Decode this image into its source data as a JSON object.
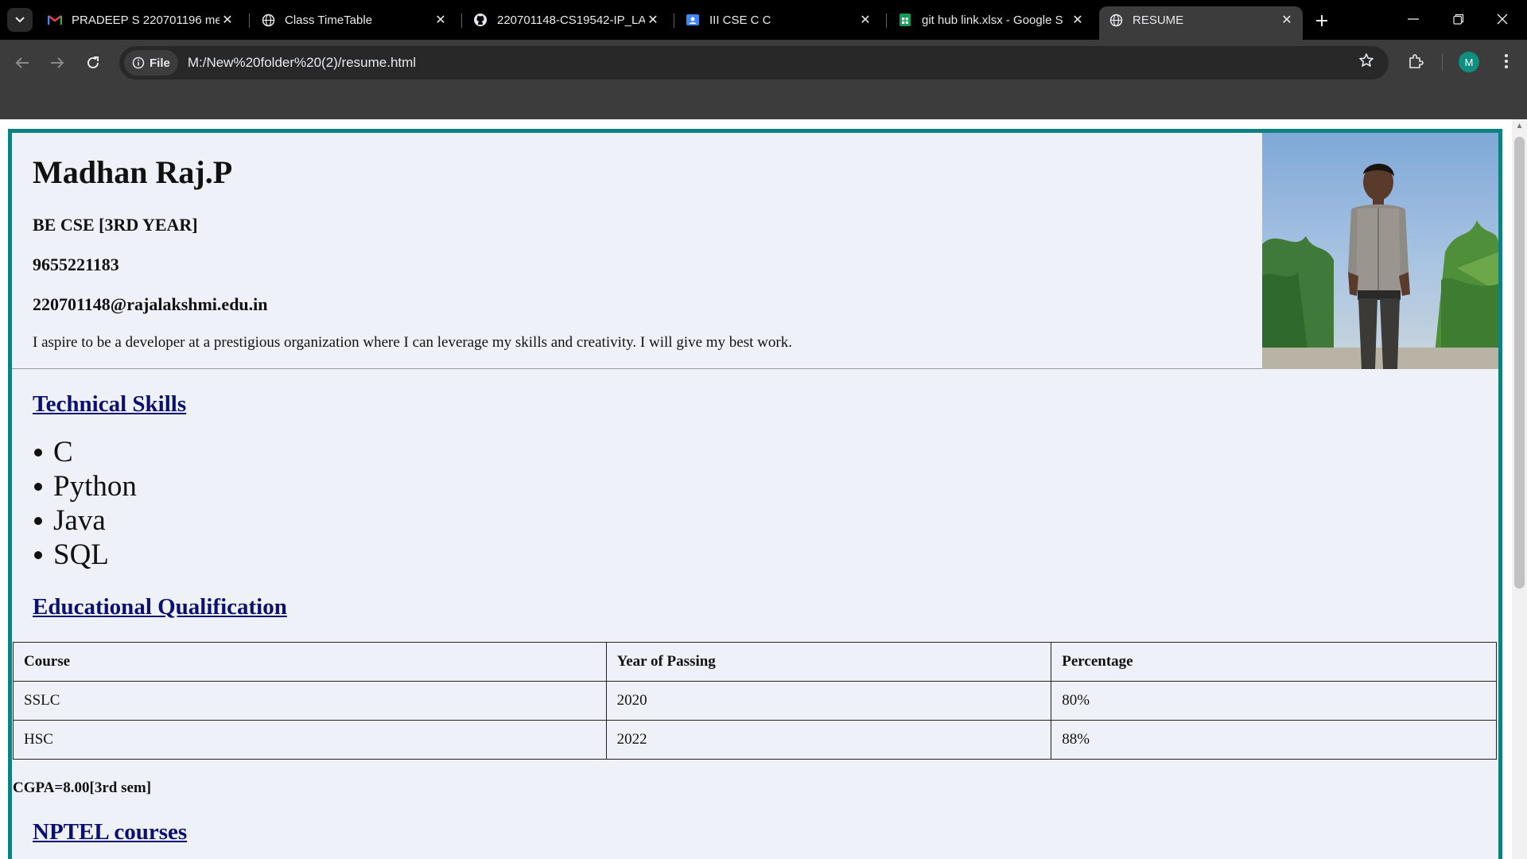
{
  "browser": {
    "tabs": [
      {
        "title": "PRADEEP S 220701196 me",
        "favicon": "gmail-icon",
        "active": false
      },
      {
        "title": "Class TimeTable",
        "favicon": "globe-icon",
        "active": false
      },
      {
        "title": "220701148-CS19542-IP_LA",
        "favicon": "github-icon",
        "active": false
      },
      {
        "title": "III CSE C C",
        "favicon": "classroom-icon",
        "active": false
      },
      {
        "title": "git hub link.xlsx - Google S",
        "favicon": "sheets-icon",
        "active": false
      },
      {
        "title": "RESUME",
        "favicon": "globe-icon",
        "active": true
      }
    ],
    "address": {
      "chip_label": "File",
      "url": "M:/New%20folder%20(2)/resume.html"
    },
    "profile_initial": "M",
    "accent_colors": {
      "profile": "#0f8f7f",
      "gmail": "#ea4335",
      "sheets": "#0f9d58",
      "classroom": "#4285f4"
    }
  },
  "resume": {
    "name": "Madhan Raj.P",
    "degree": "BE CSE [3RD YEAR]",
    "phone": "9655221183",
    "email": "220701148@rajalakshmi.edu.in",
    "objective": "I aspire to be a developer at a prestigious organization where I can leverage my skills and creativity. I will give my best work.",
    "border_color": "#0f8080",
    "background_color": "#eef2f8",
    "technical_skills": {
      "title": "Technical Skills",
      "items": [
        "C",
        "Python",
        "Java",
        "SQL"
      ]
    },
    "education": {
      "title": "Educational Qualification",
      "columns": [
        "Course",
        "Year of Passing",
        "Percentage"
      ],
      "rows": [
        [
          "SSLC",
          "2020",
          "80%"
        ],
        [
          "HSC",
          "2022",
          "88%"
        ]
      ],
      "cgpa": "CGPA=8.00[3rd sem]"
    },
    "nptel": {
      "title": "NPTEL courses"
    }
  }
}
